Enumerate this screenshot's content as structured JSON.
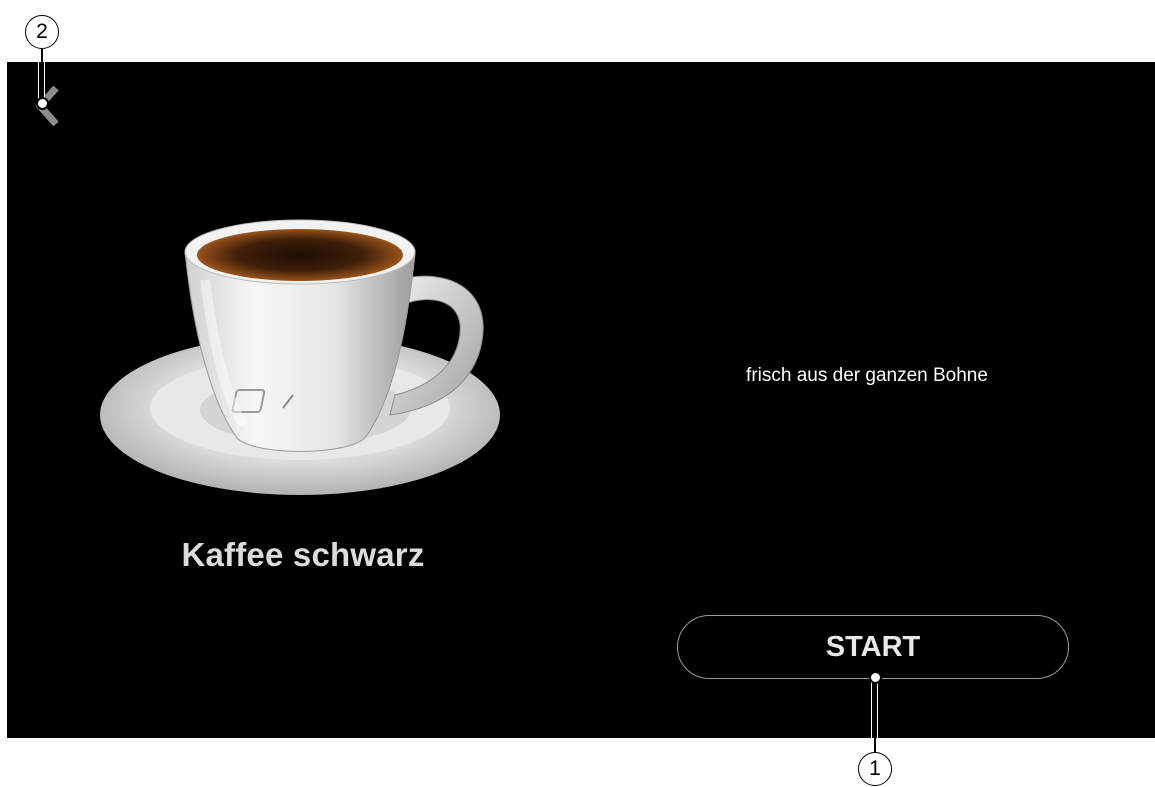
{
  "screen": {
    "product": {
      "name": "Kaffee schwarz",
      "image": "coffee-cup-on-saucer"
    },
    "description": "frisch aus der ganzen Bohne",
    "start_label": "START",
    "back_icon": "chevron-left-icon",
    "colors": {
      "background": "#000000",
      "text": "#ffffff",
      "button_border": "#9a9a9a"
    }
  },
  "callouts": {
    "start": "1",
    "back": "2"
  }
}
